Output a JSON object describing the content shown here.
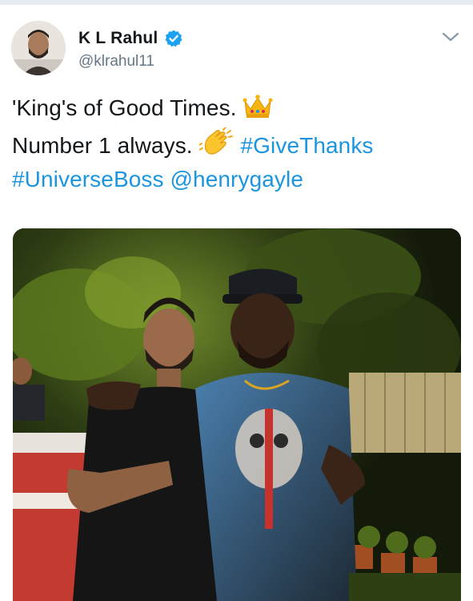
{
  "tweet": {
    "author": {
      "display_name": "K L Rahul",
      "handle": "@klrahul11",
      "verified": true,
      "verified_color": "#1da1f2"
    },
    "text": {
      "line1": "'King's of Good Times.",
      "line2": "Number 1 always.",
      "hashtag_givethanks": "#GiveThanks",
      "hashtag_universeboss": "#UniverseBoss",
      "mention": "@henrygayle"
    },
    "emojis": {
      "line1": "crown-icon",
      "line2": "clapping-hands-icon"
    },
    "link_color": "#1b95e0",
    "media": {
      "type": "photo",
      "icon": "photo"
    },
    "menu_icon": "chevron-down-icon"
  }
}
